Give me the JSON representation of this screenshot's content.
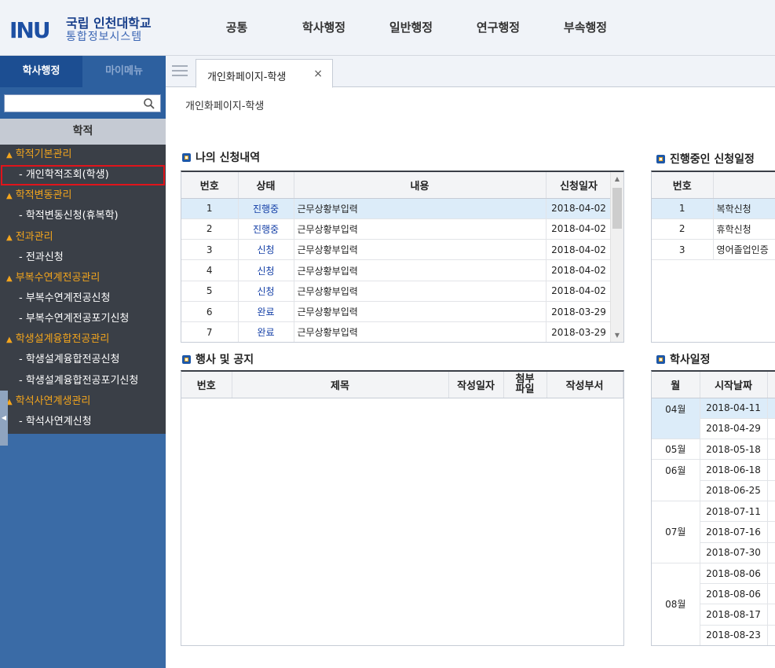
{
  "header": {
    "logo_mark": "INU",
    "logo_name_line1": "국립 인천대학교",
    "logo_name_line2": "통합정보시스템",
    "nav": [
      "공통",
      "학사행정",
      "일반행정",
      "연구행정",
      "부속행정"
    ]
  },
  "sidebar": {
    "tabs": [
      "학사행정",
      "마이메뉴"
    ],
    "search": {
      "value": "",
      "placeholder": ""
    },
    "section_title": "학적",
    "menu": [
      {
        "type": "group",
        "label": "학적기본관리"
      },
      {
        "type": "item",
        "label": "- 개인학적조회(학생)",
        "selected": true
      },
      {
        "type": "group",
        "label": "학적변동관리"
      },
      {
        "type": "item",
        "label": "- 학적변동신청(휴복학)"
      },
      {
        "type": "group",
        "label": "전과관리"
      },
      {
        "type": "item",
        "label": "- 전과신청"
      },
      {
        "type": "group",
        "label": "부복수연계전공관리"
      },
      {
        "type": "item",
        "label": "- 부복수연계전공신청"
      },
      {
        "type": "item",
        "label": "- 부복수연계전공포기신청"
      },
      {
        "type": "group",
        "label": "학생설계융합전공관리"
      },
      {
        "type": "item",
        "label": "- 학생설계융합전공신청"
      },
      {
        "type": "item",
        "label": "- 학생설계융합전공포기신청"
      },
      {
        "type": "group",
        "label": "학석사연계생관리"
      },
      {
        "type": "item",
        "label": "- 학석사연계신청"
      }
    ]
  },
  "tabs": {
    "open": [
      {
        "label": "개인화페이지-학생",
        "close": "×"
      }
    ]
  },
  "page": {
    "title": "개인화페이지-학생"
  },
  "my_applications": {
    "title": "나의 신청내역",
    "headers": [
      "번호",
      "상태",
      "내용",
      "신청일자"
    ],
    "rows": [
      [
        "1",
        "진행중",
        "근무상황부입력",
        "2018-04-02"
      ],
      [
        "2",
        "진행중",
        "근무상황부입력",
        "2018-04-02"
      ],
      [
        "3",
        "신청",
        "근무상황부입력",
        "2018-04-02"
      ],
      [
        "4",
        "신청",
        "근무상황부입력",
        "2018-04-02"
      ],
      [
        "5",
        "신청",
        "근무상황부입력",
        "2018-04-02"
      ],
      [
        "6",
        "완료",
        "근무상황부입력",
        "2018-03-29"
      ],
      [
        "7",
        "완료",
        "근무상황부입력",
        "2018-03-29"
      ]
    ]
  },
  "ongoing_schedule": {
    "title": "진행중인 신청일정",
    "headers": [
      "번호",
      ""
    ],
    "rows": [
      [
        "1",
        "복학신청"
      ],
      [
        "2",
        "휴학신청"
      ],
      [
        "3",
        "영어졸업인증"
      ]
    ]
  },
  "events": {
    "title": "행사 및 공지",
    "headers": [
      "번호",
      "제목",
      "작성일자",
      "첨부\n파일",
      "작성부서"
    ],
    "rows": []
  },
  "academic_calendar": {
    "title": "학사일정",
    "headers": [
      "월",
      "시작날짜"
    ],
    "groups": [
      {
        "month": "04월",
        "dates": [
          "2018-04-11",
          "2018-04-29"
        ]
      },
      {
        "month": "05월",
        "dates": [
          "2018-05-18"
        ]
      },
      {
        "month": "06월",
        "dates": [
          "2018-06-18",
          "2018-06-25"
        ]
      },
      {
        "month": "07월",
        "dates": [
          "2018-07-11",
          "2018-07-16",
          "2018-07-30"
        ]
      },
      {
        "month": "08월",
        "dates": [
          "2018-08-06",
          "2018-08-06",
          "2018-08-17",
          "2018-08-23"
        ]
      }
    ]
  },
  "colors": {
    "accent": "#1c4e92",
    "menu_group": "#f3a51d",
    "status_blue": "#1540a7",
    "selection_outline": "#e0141b"
  }
}
